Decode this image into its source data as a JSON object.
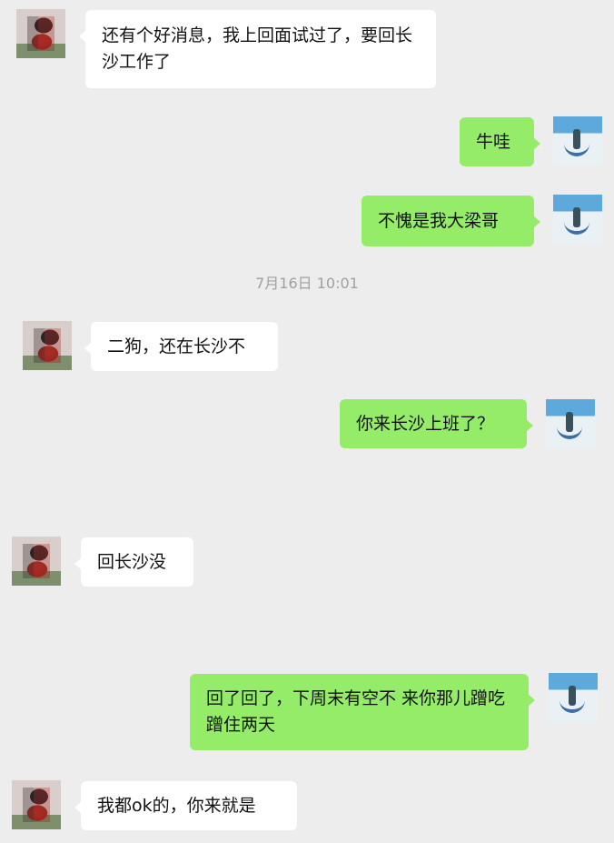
{
  "timestamp": "7月16日 10:01",
  "messages": [
    {
      "side": "left",
      "text": "还有个好消息，我上回面试过了，要回长沙工作了"
    },
    {
      "side": "right",
      "text": "牛哇"
    },
    {
      "side": "right",
      "text": "不愧是我大梁哥"
    },
    {
      "side": "left",
      "text": "二狗，还在长沙不"
    },
    {
      "side": "right",
      "text": "你来长沙上班了？"
    },
    {
      "side": "left",
      "text": "回长沙没"
    },
    {
      "side": "right",
      "text": "回了回了，下周末有空不 来你那儿蹭吃蹭住两天"
    },
    {
      "side": "left",
      "text": "我都ok的，你来就是"
    }
  ]
}
